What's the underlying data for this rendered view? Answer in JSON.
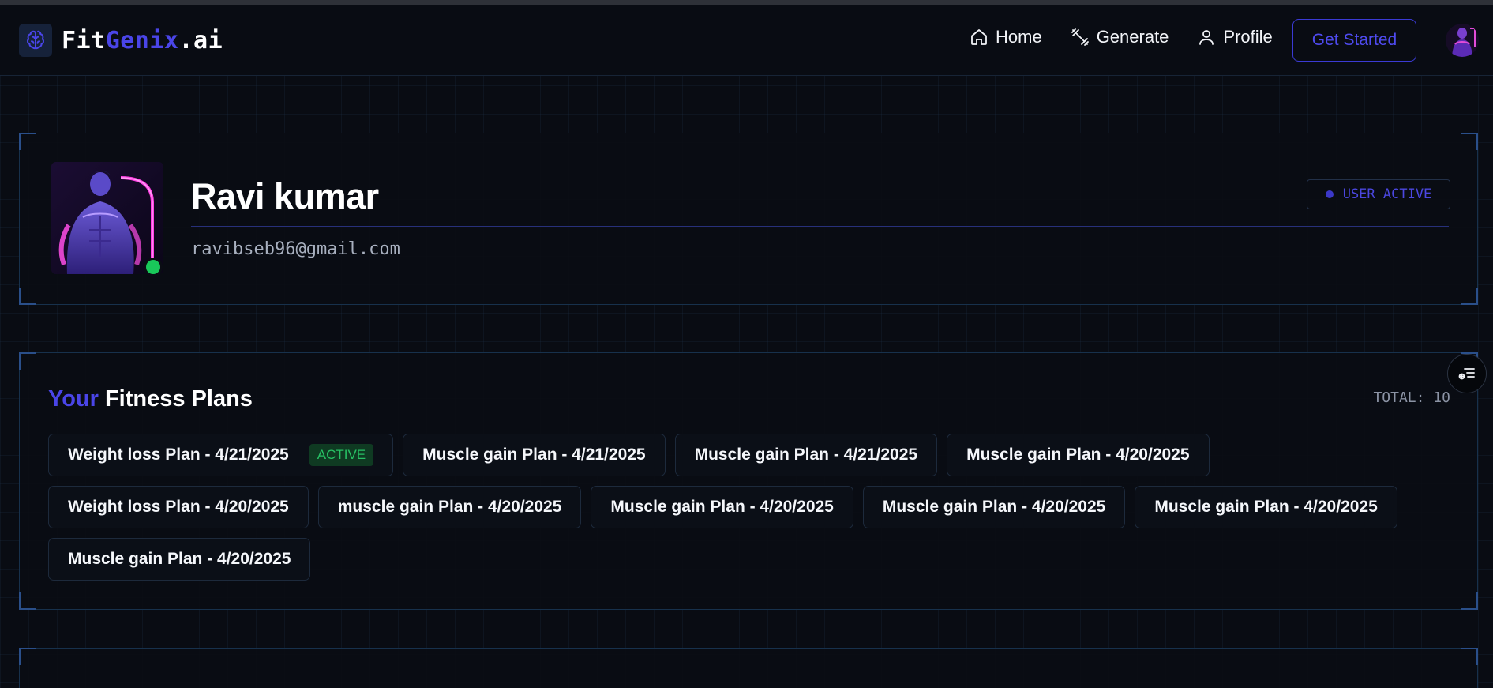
{
  "brand": {
    "part1": "Fit",
    "part2": "Genix",
    "part3": ".ai"
  },
  "nav": {
    "items": [
      {
        "label": "Home",
        "icon": "home-icon"
      },
      {
        "label": "Generate",
        "icon": "dumbbell-icon"
      },
      {
        "label": "Profile",
        "icon": "user-icon"
      }
    ],
    "cta": "Get Started"
  },
  "profile": {
    "name": "Ravi kumar",
    "email": "ravibseb96@gmail.com",
    "status": "USER ACTIVE",
    "online": true
  },
  "plans": {
    "title_accent": "Your",
    "title_rest": " Fitness Plans",
    "total": "TOTAL: 10",
    "items": [
      {
        "label": "Weight loss Plan - 4/21/2025",
        "tag": "ACTIVE"
      },
      {
        "label": "Muscle gain Plan - 4/21/2025"
      },
      {
        "label": "Muscle gain Plan - 4/21/2025"
      },
      {
        "label": "Muscle gain Plan - 4/20/2025"
      },
      {
        "label": "Weight loss Plan - 4/20/2025"
      },
      {
        "label": "muscle gain Plan - 4/20/2025"
      },
      {
        "label": "Muscle gain Plan - 4/20/2025"
      },
      {
        "label": "Muscle gain Plan - 4/20/2025"
      },
      {
        "label": "Muscle gain Plan - 4/20/2025"
      },
      {
        "label": "Muscle gain Plan - 4/20/2025"
      }
    ]
  },
  "next_section": {
    "title_rest": ""
  },
  "colors": {
    "accent": "#4a45e8",
    "active_green": "#27c064",
    "online": "#19c85a"
  }
}
